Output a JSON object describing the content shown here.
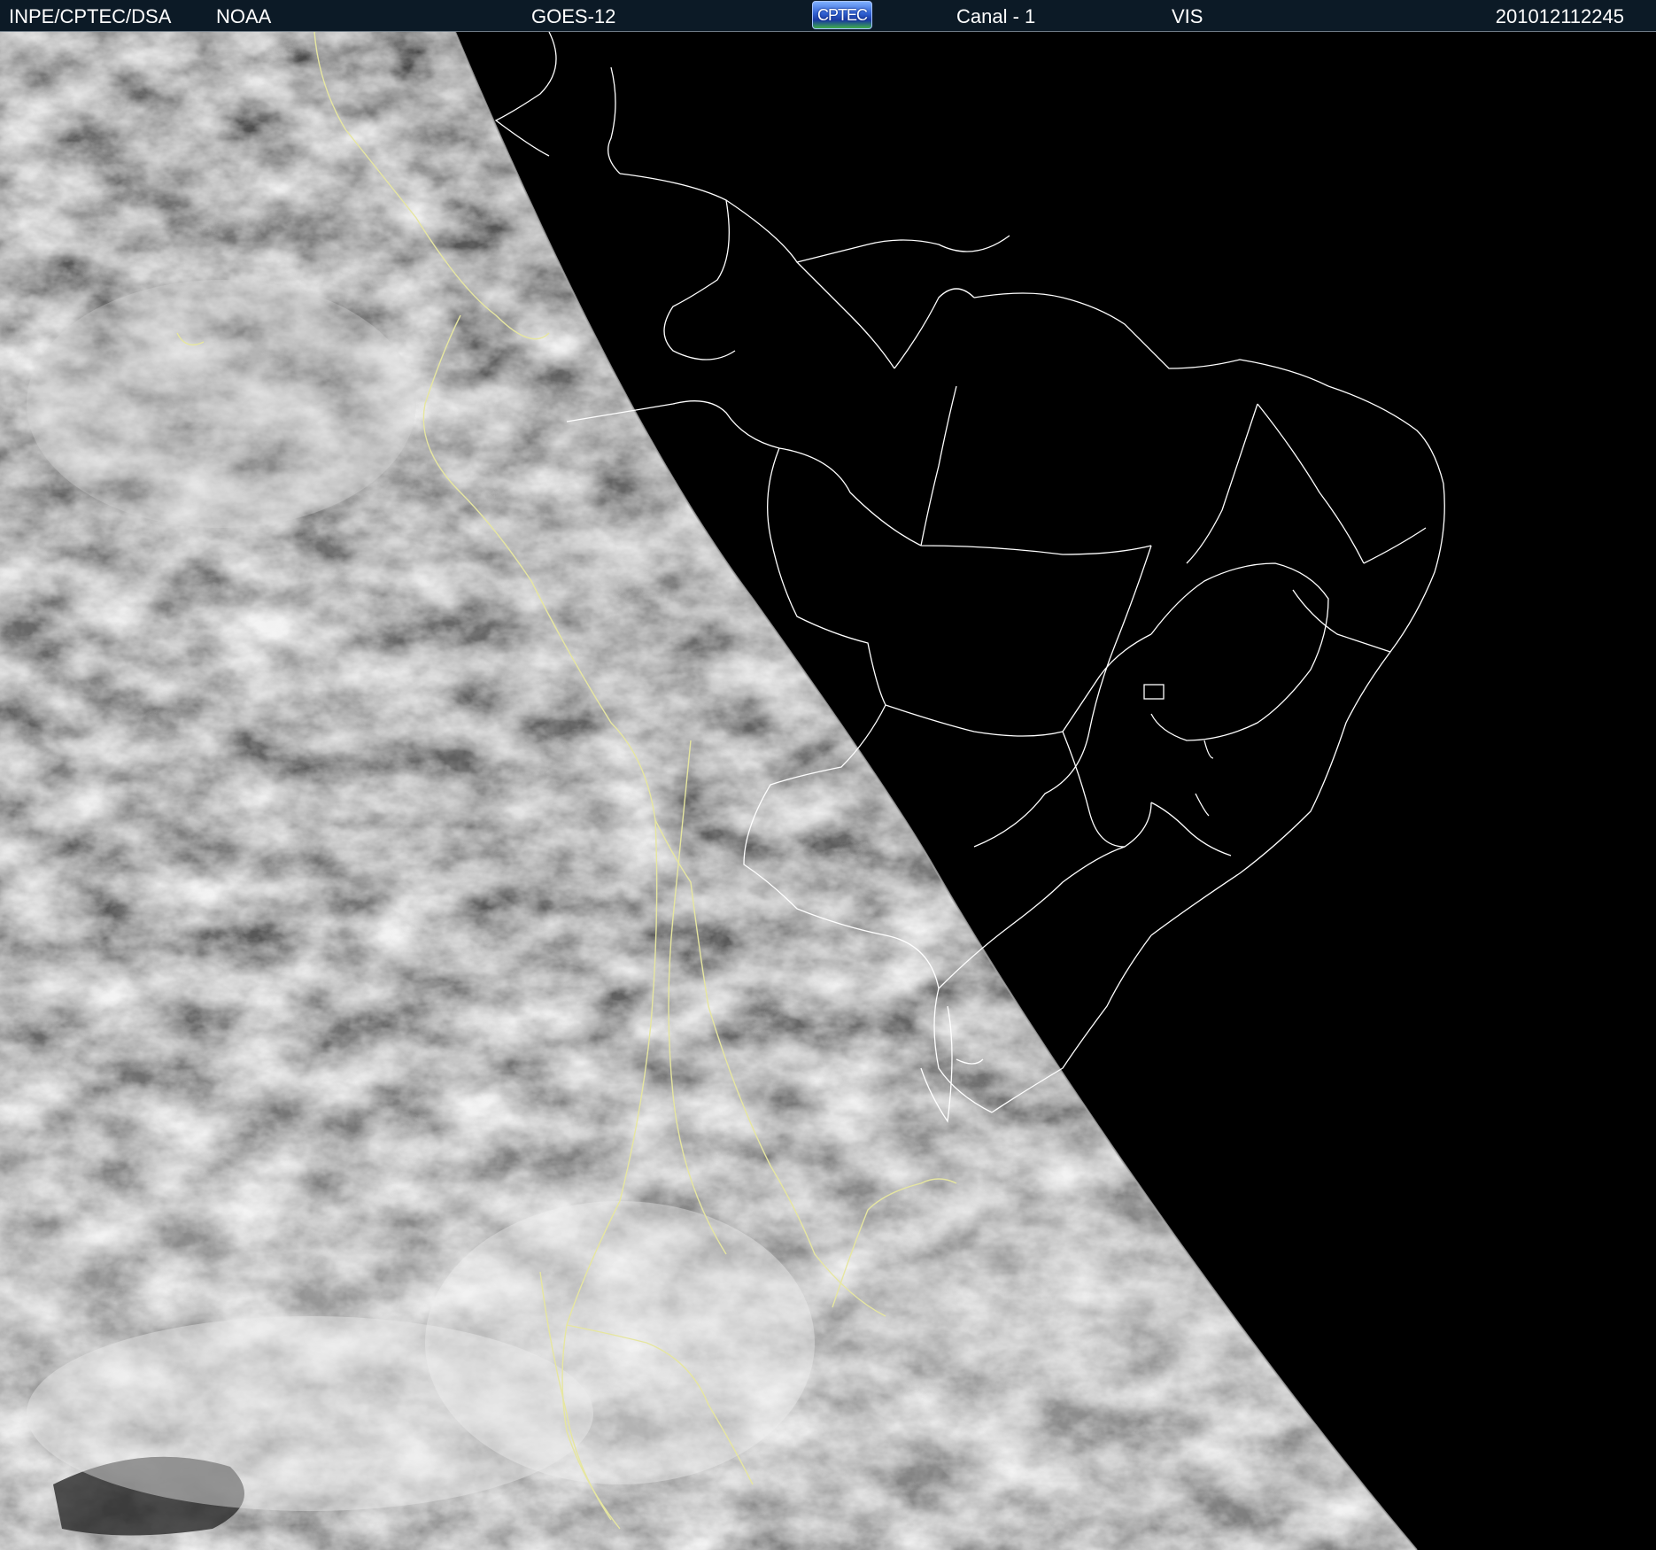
{
  "header": {
    "agency": "INPE/CPTEC/DSA",
    "source": "NOAA",
    "satellite": "GOES-12",
    "logo_text": "CPTEC",
    "channel": "Canal - 1",
    "band": "VIS",
    "timestamp": "201012112245"
  },
  "colors": {
    "header_background": "#0c1a26",
    "header_text": "#ffffff",
    "night_side": "#000000",
    "coastline_color": "#e6e6a0",
    "border_lines_night": "#ffffff"
  },
  "image": {
    "description_type": "satellite visible-channel image with day/night terminator",
    "logo_icon": "cptec-logo-icon"
  }
}
